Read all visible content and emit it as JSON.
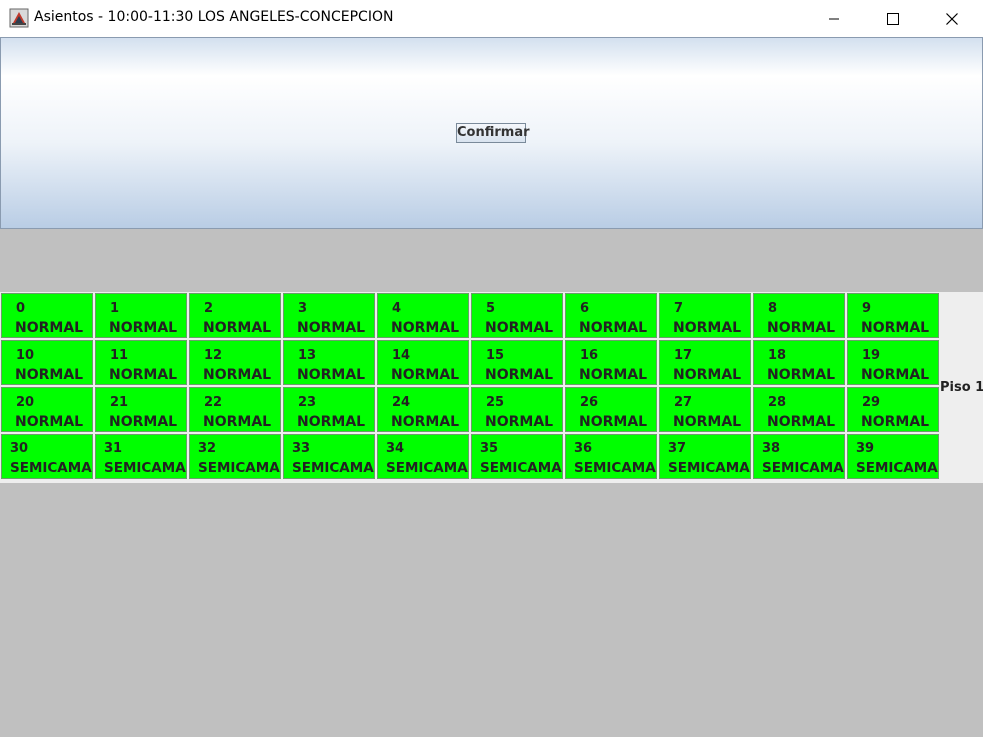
{
  "window": {
    "title": "Asientos - 10:00-11:30 LOS ANGELES-CONCEPCION"
  },
  "toolbar": {
    "confirm_label": "Confirmar"
  },
  "floor": {
    "label": "Piso 1"
  },
  "colors": {
    "seat_available": "#00ff00",
    "background": "#c0c0c0"
  },
  "seats": [
    {
      "number": "0",
      "type": "NORMAL"
    },
    {
      "number": "1",
      "type": "NORMAL"
    },
    {
      "number": "2",
      "type": "NORMAL"
    },
    {
      "number": "3",
      "type": "NORMAL"
    },
    {
      "number": "4",
      "type": "NORMAL"
    },
    {
      "number": "5",
      "type": "NORMAL"
    },
    {
      "number": "6",
      "type": "NORMAL"
    },
    {
      "number": "7",
      "type": "NORMAL"
    },
    {
      "number": "8",
      "type": "NORMAL"
    },
    {
      "number": "9",
      "type": "NORMAL"
    },
    {
      "number": "10",
      "type": "NORMAL"
    },
    {
      "number": "11",
      "type": "NORMAL"
    },
    {
      "number": "12",
      "type": "NORMAL"
    },
    {
      "number": "13",
      "type": "NORMAL"
    },
    {
      "number": "14",
      "type": "NORMAL"
    },
    {
      "number": "15",
      "type": "NORMAL"
    },
    {
      "number": "16",
      "type": "NORMAL"
    },
    {
      "number": "17",
      "type": "NORMAL"
    },
    {
      "number": "18",
      "type": "NORMAL"
    },
    {
      "number": "19",
      "type": "NORMAL"
    },
    {
      "number": "20",
      "type": "NORMAL"
    },
    {
      "number": "21",
      "type": "NORMAL"
    },
    {
      "number": "22",
      "type": "NORMAL"
    },
    {
      "number": "23",
      "type": "NORMAL"
    },
    {
      "number": "24",
      "type": "NORMAL"
    },
    {
      "number": "25",
      "type": "NORMAL"
    },
    {
      "number": "26",
      "type": "NORMAL"
    },
    {
      "number": "27",
      "type": "NORMAL"
    },
    {
      "number": "28",
      "type": "NORMAL"
    },
    {
      "number": "29",
      "type": "NORMAL"
    },
    {
      "number": "30",
      "type": "SEMICAMA"
    },
    {
      "number": "31",
      "type": "SEMICAMA"
    },
    {
      "number": "32",
      "type": "SEMICAMA"
    },
    {
      "number": "33",
      "type": "SEMICAMA"
    },
    {
      "number": "34",
      "type": "SEMICAMA"
    },
    {
      "number": "35",
      "type": "SEMICAMA"
    },
    {
      "number": "36",
      "type": "SEMICAMA"
    },
    {
      "number": "37",
      "type": "SEMICAMA"
    },
    {
      "number": "38",
      "type": "SEMICAMA"
    },
    {
      "number": "39",
      "type": "SEMICAMA"
    }
  ]
}
